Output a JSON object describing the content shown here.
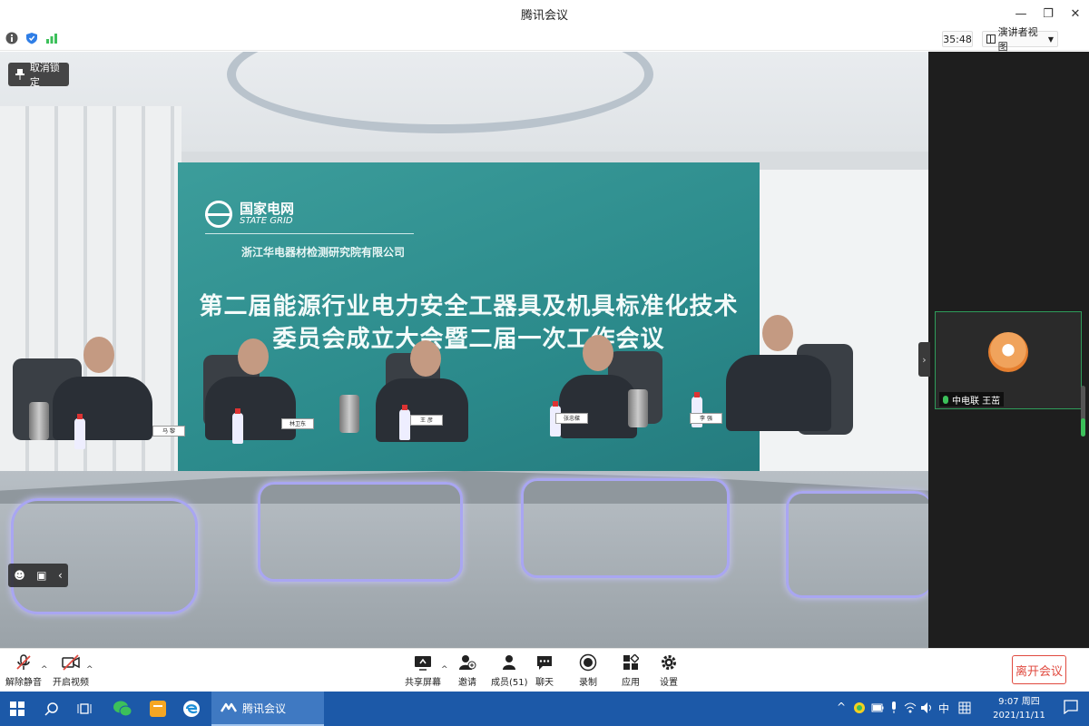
{
  "window": {
    "title": "腾讯会议"
  },
  "status_bar": {
    "timer": "35:48",
    "view_mode": "演讲者视图",
    "icons": [
      "info-icon",
      "shield-icon",
      "signal-icon"
    ]
  },
  "stage": {
    "unlock_label": "取消锁定",
    "banner": {
      "logo_cn": "国家电网",
      "logo_en": "STATE GRID",
      "company": "浙江华电器材检测研究院有限公司",
      "line1": "第二届能源行业电力安全工器具及机具标准化技术",
      "line2": "委员会成立大会暨二届一次工作会议"
    },
    "nameplates": [
      "马 黎",
      "林卫东",
      "王 彦",
      "张忠樑",
      "李 强"
    ]
  },
  "participant": {
    "name": "中电联 王茁"
  },
  "toolbar": {
    "mute": "解除静音",
    "video": "开启视频",
    "share": "共享屏幕",
    "invite": "邀请",
    "members": "成员(51)",
    "chat": "聊天",
    "record": "录制",
    "apps": "应用",
    "settings": "设置",
    "leave": "离开会议"
  },
  "taskbar": {
    "app_label": "腾讯会议",
    "ime": "中",
    "time": "9:07 周四",
    "date": "2021/11/11"
  },
  "colors": {
    "accent_red": "#e04a3f",
    "taskbar_blue": "#1c59a8",
    "banner_teal": "#2b8a8b",
    "active_green": "#3cc05a"
  }
}
